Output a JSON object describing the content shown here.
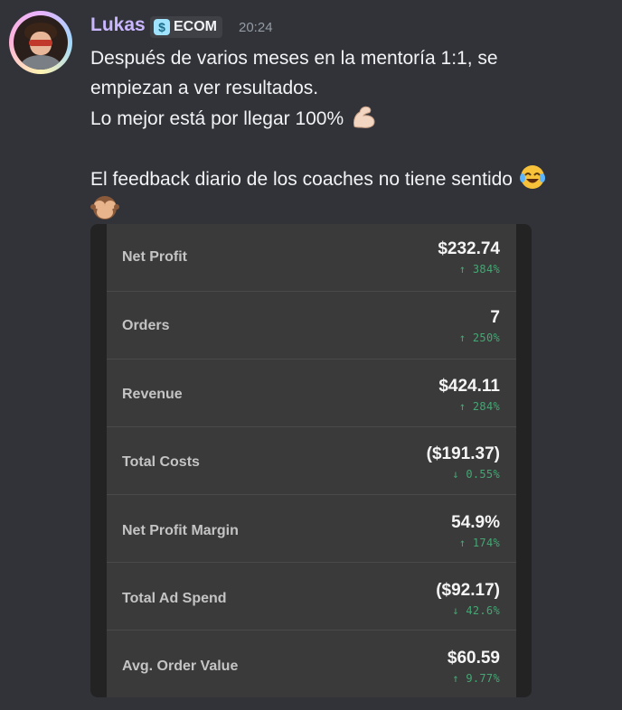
{
  "message": {
    "username": "Lukas",
    "tag": {
      "icon": "server-tag-icon",
      "label": "ECOM"
    },
    "timestamp": "20:24",
    "lines": [
      "Después de varios meses en la mentoría 1:1, se",
      "empiezan a ver resultados.",
      "Lo mejor está por llegar 100%",
      "",
      "El feedback diario de los coaches no tiene sentido"
    ],
    "emojis": [
      "flexed-biceps-emoji",
      "tears-of-joy-emoji",
      "see-no-evil-monkey-emoji"
    ]
  },
  "colors": {
    "background": "#313338",
    "username": "#c9b6ff",
    "card_bg": "#3a3a3a",
    "positive": "#44a774"
  },
  "stats": [
    {
      "label": "Net Profit",
      "value": "$232.74",
      "change": "↑ 384%"
    },
    {
      "label": "Orders",
      "value": "7",
      "change": "↑ 250%"
    },
    {
      "label": "Revenue",
      "value": "$424.11",
      "change": "↑ 284%"
    },
    {
      "label": "Total Costs",
      "value": "($191.37)",
      "change": "↓ 0.55%"
    },
    {
      "label": "Net Profit Margin",
      "value": "54.9%",
      "change": "↑ 174%"
    },
    {
      "label": "Total Ad Spend",
      "value": "($92.17)",
      "change": "↓ 42.6%"
    },
    {
      "label": "Avg. Order Value",
      "value": "$60.59",
      "change": "↑ 9.77%"
    }
  ]
}
